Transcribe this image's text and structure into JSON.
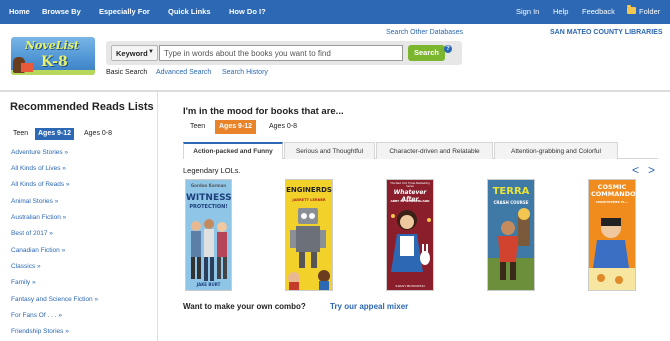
{
  "topnav": {
    "left": [
      "Home",
      "Browse By",
      "Especially For",
      "Quick Links",
      "How Do I?"
    ],
    "right": [
      "Sign In",
      "Help",
      "Feedback",
      "Folder"
    ]
  },
  "header": {
    "logo_line1": "NoveList",
    "logo_line2": "K-8",
    "search_other": "Search Other Databases",
    "library_name": "SAN MATEO COUNTY LIBRARIES",
    "search_field": "Keyword",
    "search_placeholder": "Type in words about the books you want to find",
    "search_button": "Search",
    "help": "?",
    "links": [
      "Basic Search",
      "Advanced Search",
      "Search History"
    ]
  },
  "sidebar": {
    "title": "Recommended Reads Lists",
    "tabs": [
      "Teen",
      "Ages 9-12",
      "Ages 0-8"
    ],
    "active_tab": "Ages 9-12",
    "links": [
      "Adventure Stories »",
      "All Kinds of Lives »",
      "All Kinds of Reads »",
      "Animal Stories »",
      "Australian Fiction »",
      "Best of 2017 »",
      "Canadian Fiction »",
      "Classics »",
      "Family »",
      "Fantasy and Science Fiction »",
      "For Fans Of . . . »",
      "Friendship Stories »"
    ]
  },
  "main": {
    "heading": "I'm in the mood for books that are...",
    "age_tabs": [
      "Teen",
      "Ages 9-12",
      "Ages 0-8"
    ],
    "active_age": "Ages 9-12",
    "categories": [
      "Action-packed and Funny",
      "Serious and Thoughtful",
      "Character-driven and Relatable",
      "Attention-grabbing and Colorful"
    ],
    "active_category": "Action-packed and Funny",
    "shelf_title": "Legendary LOLs.",
    "prev": "<",
    "next": ">",
    "books": [
      {
        "title": "WITNESS",
        "top_text": "Gordon Korman",
        "sub": "PROTECTION!",
        "author": "JAKE BURT",
        "bg": "#8fc6e8"
      },
      {
        "title": "ENGINERDS",
        "top_text": "",
        "sub": "",
        "author": "JARRETT LERNER",
        "bg": "#f2d12b"
      },
      {
        "title": "Whatever After",
        "top_text": "The New York Times Bestselling Series",
        "sub": "ABBY IN WONDERLAND",
        "author": "SARAH MLYNOWSKI",
        "bg": "#8a1f2b"
      },
      {
        "title": "TERRA",
        "top_text": "",
        "sub": "CRASH COURSE",
        "author": "",
        "bg": "#3f7aa6"
      },
      {
        "title": "COSMIC COMMANDOS",
        "top_text": "",
        "sub": "CHRISTOPHER EL...",
        "author": "",
        "bg": "#f08c1e"
      }
    ],
    "combo_text": "Want to make your own combo?",
    "combo_link": "Try our appeal mixer"
  }
}
